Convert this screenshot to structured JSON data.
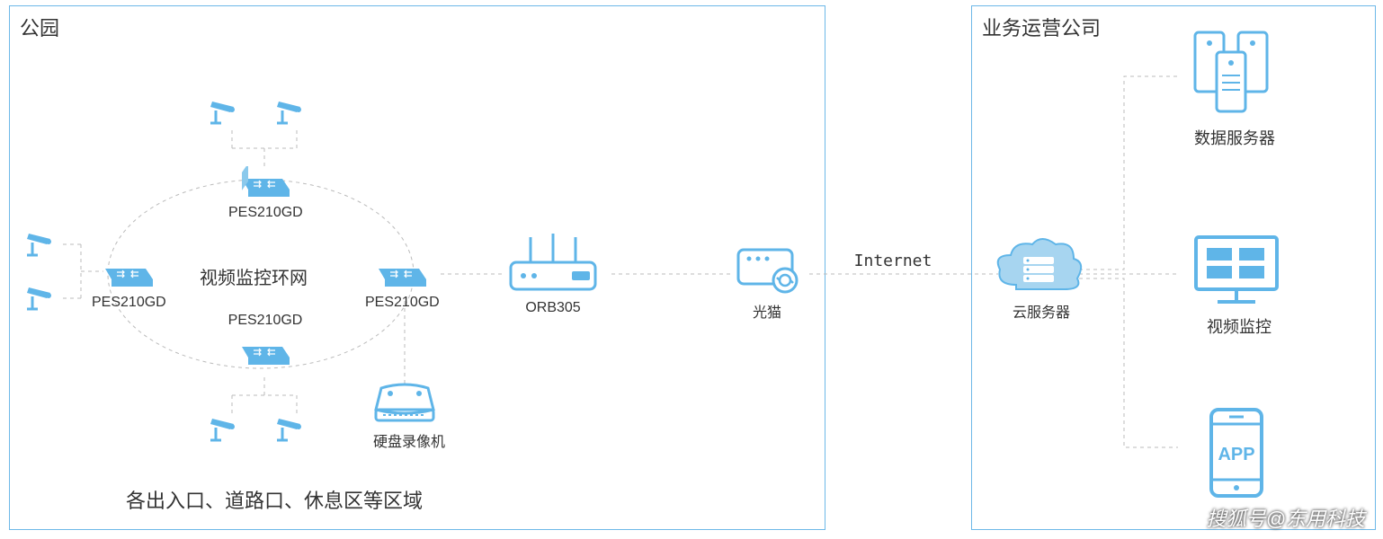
{
  "left_box_title": "公园",
  "right_box_title": "业务运营公司",
  "ring_label": "视频监控环网",
  "switch_top": "PES210GD",
  "switch_left": "PES210GD",
  "switch_bottom": "PES210GD",
  "switch_right": "PES210GD",
  "router_label": "ORB305",
  "nvr_label": "硬盘录像机",
  "modem_label": "光猫",
  "internet_label": "Internet",
  "cloud_label": "云服务器",
  "data_server_label": "数据服务器",
  "monitor_label": "视频监控",
  "app_label": "APP",
  "bottom_caption": "各出入口、道路口、休息区等区域",
  "watermark": "搜狐号@东用科技",
  "colors": {
    "blue": "#5fb5e8",
    "border": "#6db8e8"
  }
}
